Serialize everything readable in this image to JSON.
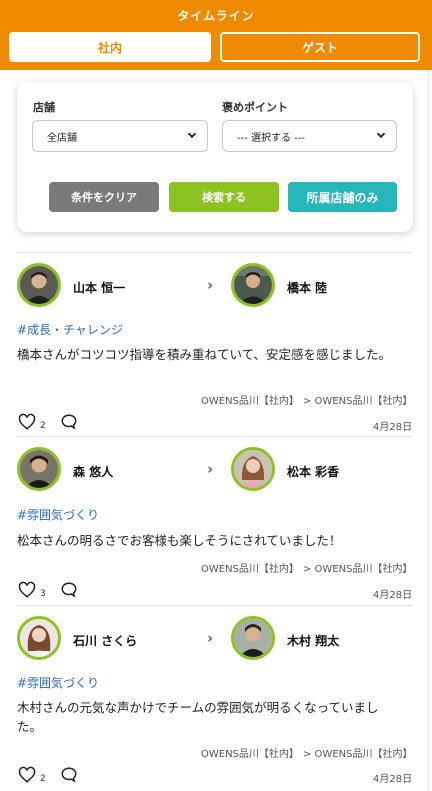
{
  "header": {
    "title": "タイムライン"
  },
  "tabs": {
    "internal": "社内",
    "guest": "ゲスト"
  },
  "filters": {
    "store_label": "店舗",
    "store_value": "全店舗",
    "point_label": "褒めポイント",
    "point_value": "--- 選択する ---",
    "clear_label": "条件をクリア",
    "search_label": "検索する",
    "own_store_label": "所属店舗のみ"
  },
  "posts": [
    {
      "from_name": "山本 恒一",
      "to_name": "橋本 陸",
      "tag": "#成長・チャレンジ",
      "message": "橋本さんがコツコツ指導を積み重ねていて、安定感を感じました。",
      "from_store": "OWENS品川【社内】",
      "to_store": "> OWENS品川【社内】",
      "likes": "2",
      "date": "4月28日"
    },
    {
      "from_name": "森 悠人",
      "to_name": "松本 彩香",
      "tag": "#雰囲気づくり",
      "message": "松本さんの明るさでお客様も楽しそうにされていました！",
      "from_store": "OWENS品川【社内】",
      "to_store": "> OWENS品川【社内】",
      "likes": "3",
      "date": "4月28日"
    },
    {
      "from_name": "石川 さくら",
      "to_name": "木村 翔太",
      "tag": "#雰囲気づくり",
      "message": "木村さんの元気な声かけでチームの雰囲気が明るくなっていました。",
      "from_store": "OWENS品川【社内】",
      "to_store": "> OWENS品川【社内】",
      "likes": "2",
      "date": "4月28日"
    }
  ]
}
